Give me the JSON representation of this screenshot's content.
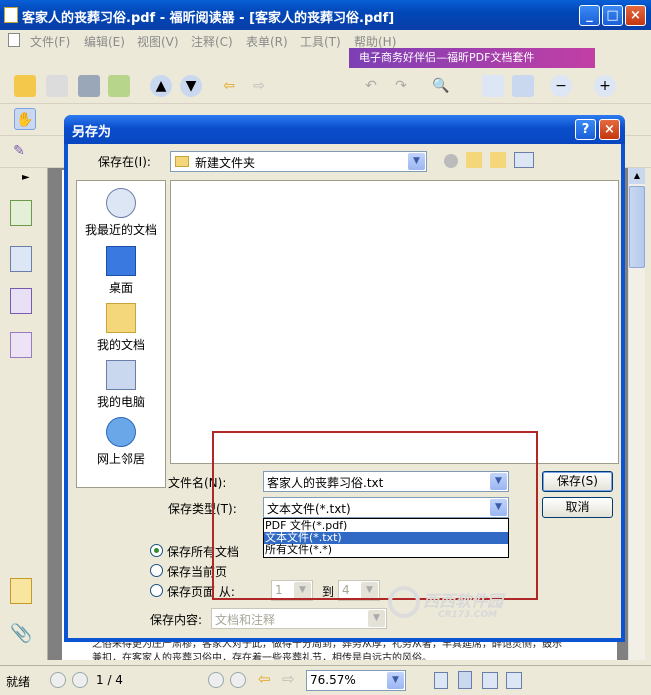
{
  "window": {
    "title": "客家人的丧葬习俗.pdf - 福昕阅读器 - [客家人的丧葬习俗.pdf]",
    "buttons": [
      "_",
      "□",
      "×"
    ]
  },
  "menu": {
    "items": [
      "文件(F)",
      "编辑(E)",
      "视图(V)",
      "注释(C)",
      "表单(R)",
      "工具(T)",
      "帮助(H)"
    ]
  },
  "banner": {
    "text": "电子商务好伴侣—福昕PDF文档套件"
  },
  "dialog": {
    "title": "另存为",
    "save_in_label": "保存在(I):",
    "save_in_value": "新建文件夹",
    "places": [
      {
        "label": "我最近的文档",
        "icon": "recent-docs-icon"
      },
      {
        "label": "桌面",
        "icon": "desktop-icon"
      },
      {
        "label": "我的文档",
        "icon": "my-documents-icon"
      },
      {
        "label": "我的电脑",
        "icon": "my-computer-icon"
      },
      {
        "label": "网上邻居",
        "icon": "network-places-icon"
      }
    ],
    "filename_label": "文件名(N):",
    "filename_value": "客家人的丧葬习俗.txt",
    "filetype_label": "保存类型(T):",
    "filetype_value": "文本文件(*.txt)",
    "filetype_options": [
      "PDF 文件(*.pdf)",
      "文本文件(*.txt)",
      "所有文件(*.*)"
    ],
    "filetype_selected_index": 1,
    "save_button": "保存(S)",
    "cancel_button": "取消",
    "radio_all": "保存所有文档",
    "radio_current": "保存当前页",
    "radio_range": "保存页面 从:",
    "range_from": "1",
    "range_to_label": "到",
    "range_to": "4",
    "content_label": "保存内容:",
    "content_value": "文档和注释"
  },
  "document": {
    "text_line1": "之俗来得更为庄严肃穆，客家人对于此，做得十分周到，葬务从厚，礼务从奢，丰其筵席，醉饱灵侧，鼓乐",
    "text_line2": "兼扣，在客家人的丧葬习俗中，存在着一些丧葬礼节，相传是自远古的风俗。"
  },
  "status": {
    "ready": "就绪",
    "page": "1 / 4",
    "zoom": "76.57%"
  },
  "watermark": {
    "text": "西西软件园",
    "sub": "CR173.COM"
  }
}
